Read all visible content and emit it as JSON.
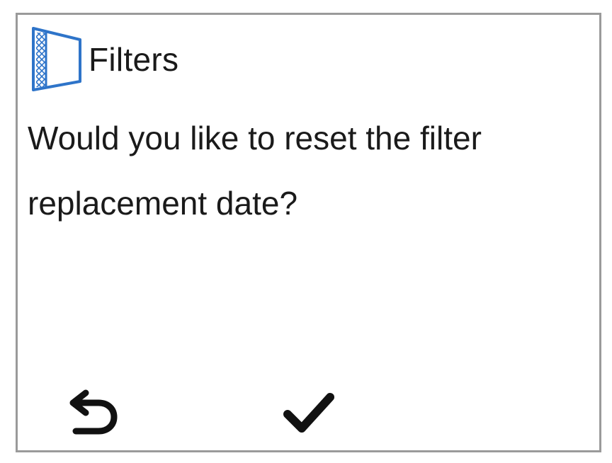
{
  "header": {
    "icon": "filter-icon",
    "title": "Filters"
  },
  "dialog": {
    "message": "Would you like to reset the filter replacement date?"
  },
  "actions": {
    "back_icon": "back-arrow-icon",
    "confirm_icon": "checkmark-icon"
  },
  "colors": {
    "accent": "#2e74c9",
    "text": "#1a1a1a",
    "frame": "#9a9a9a"
  }
}
